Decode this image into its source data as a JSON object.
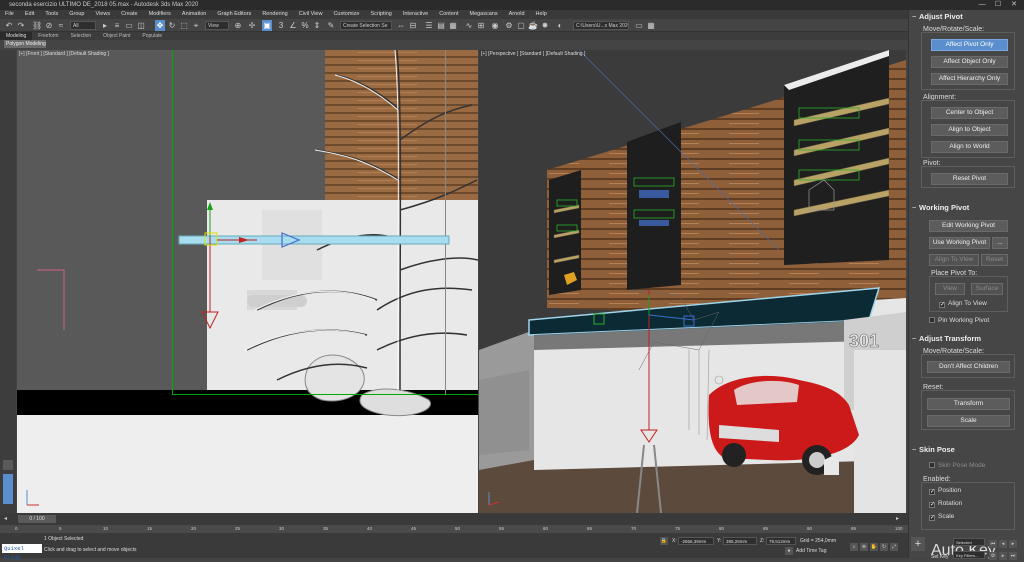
{
  "titlebar": {
    "title": "seconda esercizio ULTIMO DE_2018 05.max - Autodesk 3ds Max 2020",
    "minimize": "—",
    "maximize": "☐",
    "close": "✕"
  },
  "menu": [
    "File",
    "Edit",
    "Tools",
    "Group",
    "Views",
    "Create",
    "Modifiers",
    "Animation",
    "Graph Editors",
    "Rendering",
    "Civil View",
    "Customize",
    "Scripting",
    "Interactive",
    "Content",
    "Megascans",
    "Arnold",
    "Help"
  ],
  "toolbar": {
    "undo": "↶",
    "redo": "↷",
    "filter": "All",
    "refcoord": "View",
    "named_selection": "Create Selection Se",
    "workspace": "C:\\Users\\U...s Max 2020",
    "snap_label": "3",
    "angle_snap": "∠",
    "percent_snap": "%"
  },
  "ribbon": {
    "tabs": [
      "Modeling",
      "Freeform",
      "Selection",
      "Object Paint",
      "Populate"
    ],
    "active": "Modeling",
    "sub_tab": "Polygon Modeling"
  },
  "viewports": {
    "front_label": "[+] [Front ] [Standard ] [Default Shading ]",
    "persp_label": "[+] [Perspective ] [Standard ] [Default Shading ]",
    "house_number": "301"
  },
  "command_panel": {
    "adjust_pivot": {
      "title": "Adjust Pivot",
      "move_label": "Move/Rotate/Scale:",
      "buttons": [
        "Affect Pivot Only",
        "Affect Object Only",
        "Affect Hierarchy Only"
      ],
      "alignment_label": "Alignment:",
      "align_buttons": [
        "Center to Object",
        "Align to Object",
        "Align to World"
      ],
      "pivot_label": "Pivot:",
      "reset_pivot": "Reset Pivot"
    },
    "working_pivot": {
      "title": "Working Pivot",
      "edit": "Edit Working Pivot",
      "use": "Use Working Pivot",
      "use_more": "...",
      "align_to_view": "Align To View",
      "reset": "Reset",
      "place_label": "Place Pivot To:",
      "view": "View",
      "surface": "Surface",
      "align_view_chk": "Align To View",
      "pin": "Pin Working Pivot"
    },
    "adjust_transform": {
      "title": "Adjust Transform",
      "move_label": "Move/Rotate/Scale:",
      "dont_affect": "Don't Affect Children",
      "reset_label": "Reset:",
      "transform": "Transform",
      "scale": "Scale"
    },
    "skin_pose": {
      "title": "Skin Pose",
      "mode": "Skin Pose Mode",
      "enabled_label": "Enabled:",
      "position": "Position",
      "rotation": "Rotation",
      "scale": "Scale"
    }
  },
  "timeline": {
    "slider": "0 / 100",
    "ticks": [
      "0",
      "5",
      "10",
      "15",
      "20",
      "25",
      "30",
      "35",
      "40",
      "45",
      "50",
      "55",
      "60",
      "65",
      "70",
      "75",
      "80",
      "85",
      "90",
      "95",
      "100"
    ]
  },
  "status": {
    "maxscript": "Quixel Bridg",
    "selected": "1 Object Selected",
    "prompt": "Click and drag to select and move objects",
    "x": "-2656,39mm",
    "y": "395,26mm",
    "z": "79,513mm",
    "grid": "Grid = 254,0mm",
    "add_time_tag": "Add Time Tag",
    "auto_key": "Auto Key",
    "selected_dd": "Selected",
    "set_key": "Set Key",
    "key_filters": "Key Filters..."
  },
  "colors": {
    "accent": "#5a8ecc",
    "panel": "#464646",
    "viewport_front": "#595959"
  }
}
